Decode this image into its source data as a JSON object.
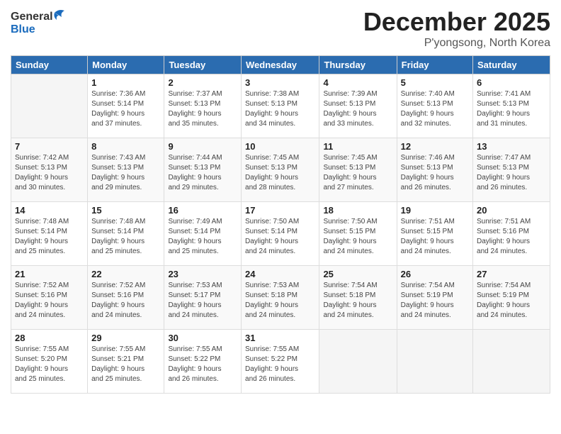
{
  "logo": {
    "line1": "General",
    "line2": "Blue"
  },
  "header": {
    "month": "December 2025",
    "location": "P'yongsong, North Korea"
  },
  "days_of_week": [
    "Sunday",
    "Monday",
    "Tuesday",
    "Wednesday",
    "Thursday",
    "Friday",
    "Saturday"
  ],
  "weeks": [
    [
      {
        "day": "",
        "info": ""
      },
      {
        "day": "1",
        "info": "Sunrise: 7:36 AM\nSunset: 5:14 PM\nDaylight: 9 hours\nand 37 minutes."
      },
      {
        "day": "2",
        "info": "Sunrise: 7:37 AM\nSunset: 5:13 PM\nDaylight: 9 hours\nand 35 minutes."
      },
      {
        "day": "3",
        "info": "Sunrise: 7:38 AM\nSunset: 5:13 PM\nDaylight: 9 hours\nand 34 minutes."
      },
      {
        "day": "4",
        "info": "Sunrise: 7:39 AM\nSunset: 5:13 PM\nDaylight: 9 hours\nand 33 minutes."
      },
      {
        "day": "5",
        "info": "Sunrise: 7:40 AM\nSunset: 5:13 PM\nDaylight: 9 hours\nand 32 minutes."
      },
      {
        "day": "6",
        "info": "Sunrise: 7:41 AM\nSunset: 5:13 PM\nDaylight: 9 hours\nand 31 minutes."
      }
    ],
    [
      {
        "day": "7",
        "info": "Sunrise: 7:42 AM\nSunset: 5:13 PM\nDaylight: 9 hours\nand 30 minutes."
      },
      {
        "day": "8",
        "info": "Sunrise: 7:43 AM\nSunset: 5:13 PM\nDaylight: 9 hours\nand 29 minutes."
      },
      {
        "day": "9",
        "info": "Sunrise: 7:44 AM\nSunset: 5:13 PM\nDaylight: 9 hours\nand 29 minutes."
      },
      {
        "day": "10",
        "info": "Sunrise: 7:45 AM\nSunset: 5:13 PM\nDaylight: 9 hours\nand 28 minutes."
      },
      {
        "day": "11",
        "info": "Sunrise: 7:45 AM\nSunset: 5:13 PM\nDaylight: 9 hours\nand 27 minutes."
      },
      {
        "day": "12",
        "info": "Sunrise: 7:46 AM\nSunset: 5:13 PM\nDaylight: 9 hours\nand 26 minutes."
      },
      {
        "day": "13",
        "info": "Sunrise: 7:47 AM\nSunset: 5:13 PM\nDaylight: 9 hours\nand 26 minutes."
      }
    ],
    [
      {
        "day": "14",
        "info": "Sunrise: 7:48 AM\nSunset: 5:14 PM\nDaylight: 9 hours\nand 25 minutes."
      },
      {
        "day": "15",
        "info": "Sunrise: 7:48 AM\nSunset: 5:14 PM\nDaylight: 9 hours\nand 25 minutes."
      },
      {
        "day": "16",
        "info": "Sunrise: 7:49 AM\nSunset: 5:14 PM\nDaylight: 9 hours\nand 25 minutes."
      },
      {
        "day": "17",
        "info": "Sunrise: 7:50 AM\nSunset: 5:14 PM\nDaylight: 9 hours\nand 24 minutes."
      },
      {
        "day": "18",
        "info": "Sunrise: 7:50 AM\nSunset: 5:15 PM\nDaylight: 9 hours\nand 24 minutes."
      },
      {
        "day": "19",
        "info": "Sunrise: 7:51 AM\nSunset: 5:15 PM\nDaylight: 9 hours\nand 24 minutes."
      },
      {
        "day": "20",
        "info": "Sunrise: 7:51 AM\nSunset: 5:16 PM\nDaylight: 9 hours\nand 24 minutes."
      }
    ],
    [
      {
        "day": "21",
        "info": "Sunrise: 7:52 AM\nSunset: 5:16 PM\nDaylight: 9 hours\nand 24 minutes."
      },
      {
        "day": "22",
        "info": "Sunrise: 7:52 AM\nSunset: 5:16 PM\nDaylight: 9 hours\nand 24 minutes."
      },
      {
        "day": "23",
        "info": "Sunrise: 7:53 AM\nSunset: 5:17 PM\nDaylight: 9 hours\nand 24 minutes."
      },
      {
        "day": "24",
        "info": "Sunrise: 7:53 AM\nSunset: 5:18 PM\nDaylight: 9 hours\nand 24 minutes."
      },
      {
        "day": "25",
        "info": "Sunrise: 7:54 AM\nSunset: 5:18 PM\nDaylight: 9 hours\nand 24 minutes."
      },
      {
        "day": "26",
        "info": "Sunrise: 7:54 AM\nSunset: 5:19 PM\nDaylight: 9 hours\nand 24 minutes."
      },
      {
        "day": "27",
        "info": "Sunrise: 7:54 AM\nSunset: 5:19 PM\nDaylight: 9 hours\nand 24 minutes."
      }
    ],
    [
      {
        "day": "28",
        "info": "Sunrise: 7:55 AM\nSunset: 5:20 PM\nDaylight: 9 hours\nand 25 minutes."
      },
      {
        "day": "29",
        "info": "Sunrise: 7:55 AM\nSunset: 5:21 PM\nDaylight: 9 hours\nand 25 minutes."
      },
      {
        "day": "30",
        "info": "Sunrise: 7:55 AM\nSunset: 5:22 PM\nDaylight: 9 hours\nand 26 minutes."
      },
      {
        "day": "31",
        "info": "Sunrise: 7:55 AM\nSunset: 5:22 PM\nDaylight: 9 hours\nand 26 minutes."
      },
      {
        "day": "",
        "info": ""
      },
      {
        "day": "",
        "info": ""
      },
      {
        "day": "",
        "info": ""
      }
    ]
  ]
}
